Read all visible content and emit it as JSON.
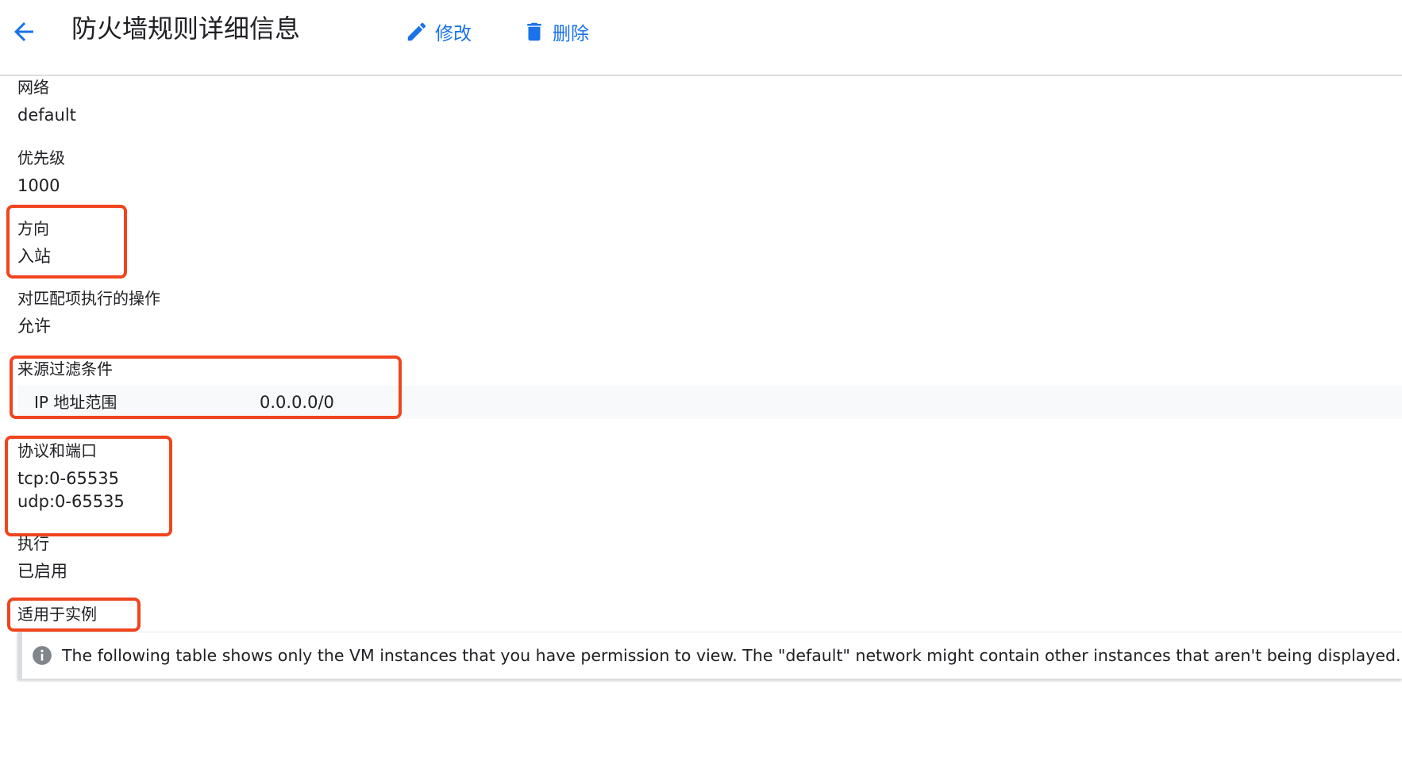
{
  "header": {
    "title": "防火墙规则详细信息",
    "edit_label": "修改",
    "delete_label": "删除"
  },
  "fields": {
    "network": {
      "label": "网络",
      "value": "default"
    },
    "priority": {
      "label": "优先级",
      "value": "1000"
    },
    "direction": {
      "label": "方向",
      "value": "入站"
    },
    "action": {
      "label": "对匹配项执行的操作",
      "value": "允许"
    },
    "source_filter": {
      "label": "来源过滤条件",
      "rows": [
        {
          "key": "IP 地址范围",
          "value": "0.0.0.0/0"
        }
      ]
    },
    "protocols": {
      "label": "协议和端口",
      "values": [
        "tcp:0-65535",
        "udp:0-65535"
      ]
    },
    "enforcement": {
      "label": "执行",
      "value": "已启用"
    },
    "applies_to": {
      "label": "适用于实例"
    }
  },
  "info_banner": {
    "icon": "info-icon",
    "text": "The following table shows only the VM instances that you have permission to view. The \"default\" network might contain other instances that aren't being displayed."
  },
  "colors": {
    "accent": "#1a73e8",
    "highlight": "#f0441f",
    "text": "#202124"
  }
}
